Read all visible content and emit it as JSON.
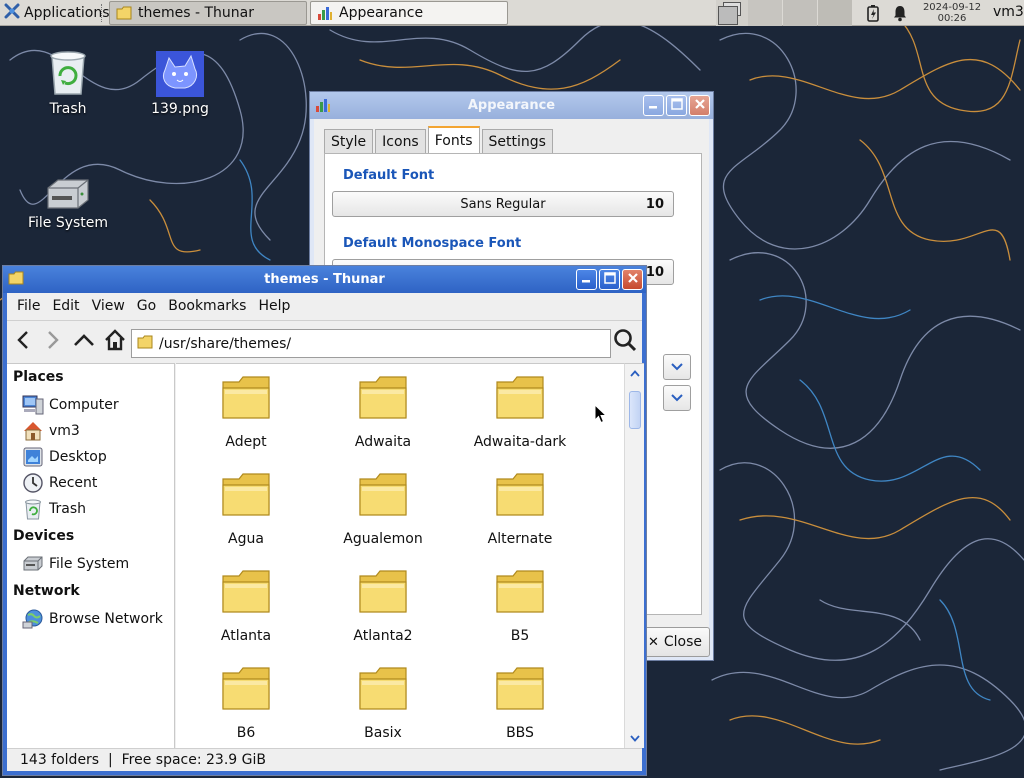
{
  "panel": {
    "applications_label": "Applications",
    "tasks": [
      {
        "label": "themes - Thunar",
        "icon": "folder-icon"
      },
      {
        "label": "Appearance",
        "icon": "appearance-icon"
      }
    ],
    "clock": {
      "date": "2024-09-12",
      "time": "00:26"
    },
    "user": "vm3"
  },
  "desktop": {
    "icons": [
      {
        "label": "Trash",
        "icon": "trash-icon"
      },
      {
        "label": "139.png",
        "icon": "image-file-icon"
      },
      {
        "label": "File System",
        "icon": "drive-icon"
      }
    ]
  },
  "appearance": {
    "title": "Appearance",
    "tabs": [
      "Style",
      "Icons",
      "Fonts",
      "Settings"
    ],
    "active_tab": "Fonts",
    "default_font_heading": "Default Font",
    "default_font_name": "Sans Regular",
    "default_font_size": "10",
    "mono_font_heading": "Default Monospace Font",
    "mono_font_size": "10",
    "close_label": "Close"
  },
  "thunar": {
    "title": "themes - Thunar",
    "menu": [
      "File",
      "Edit",
      "View",
      "Go",
      "Bookmarks",
      "Help"
    ],
    "location": "/usr/share/themes/",
    "sidebar": {
      "places_heading": "Places",
      "places": [
        {
          "label": "Computer",
          "icon": "computer-icon"
        },
        {
          "label": "vm3",
          "icon": "home-icon"
        },
        {
          "label": "Desktop",
          "icon": "desktop-icon"
        },
        {
          "label": "Recent",
          "icon": "recent-icon"
        },
        {
          "label": "Trash",
          "icon": "trash-icon"
        }
      ],
      "devices_heading": "Devices",
      "devices": [
        {
          "label": "File System",
          "icon": "drive-icon"
        }
      ],
      "network_heading": "Network",
      "network": [
        {
          "label": "Browse Network",
          "icon": "network-icon"
        }
      ]
    },
    "folders": [
      "Adept",
      "Adwaita",
      "Adwaita-dark",
      "Agua",
      "Agualemon",
      "Alternate",
      "Atlanta",
      "Atlanta2",
      "B5",
      "B6",
      "Basix",
      "BBS"
    ],
    "status": "143 folders  |  Free space: 23.9 GiB"
  },
  "colors": {
    "titlebar_active": "#3a72d6",
    "section_heading": "#1a56b8",
    "folder_yellow": "#f5d45a",
    "wallpaper_bg": "#1b2638"
  }
}
